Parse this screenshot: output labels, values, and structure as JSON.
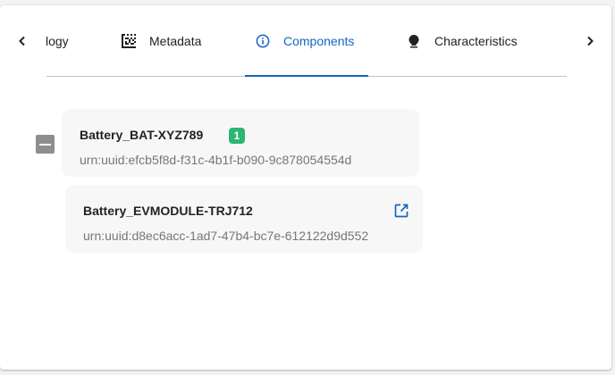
{
  "tabs": [
    {
      "label": "logy",
      "icon": "none",
      "active": false
    },
    {
      "label": "Metadata",
      "icon": "datamatrix-icon",
      "active": false
    },
    {
      "label": "Components",
      "icon": "info-icon",
      "active": true
    },
    {
      "label": "Characteristics",
      "icon": "lightbulb-icon",
      "active": false
    }
  ],
  "colors": {
    "accent": "#1565c0",
    "badge": "#2bb673",
    "collapse_button": "#8e8e8e"
  },
  "tree": {
    "parent": {
      "name": "Battery_BAT-XYZ789",
      "badge_count": "1",
      "uuid": "urn:uuid:efcb5f8d-f31c-4b1f-b090-9c878054554d"
    },
    "children": [
      {
        "name": "Battery_EVMODULE-TRJ712",
        "uuid": "urn:uuid:d8ec6acc-1ad7-47b4-bc7e-612122d9d552"
      }
    ]
  }
}
